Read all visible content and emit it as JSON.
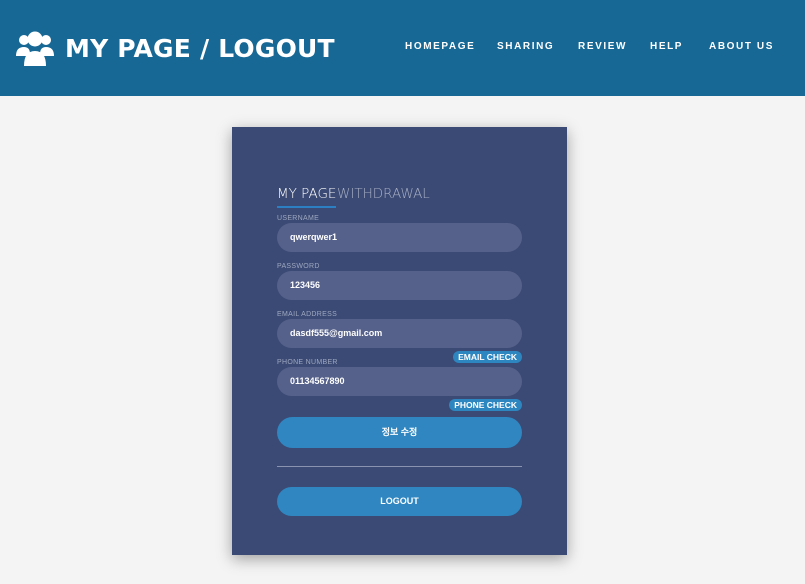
{
  "header": {
    "title": "MY PAGE / LOGOUT",
    "logo_icon": "users-icon",
    "background_color": "#176895",
    "nav": [
      {
        "label": "HOMEPAGE"
      },
      {
        "label": "SHARING"
      },
      {
        "label": "REVIEW"
      },
      {
        "label": "HELP"
      },
      {
        "label": "ABOUT US"
      }
    ]
  },
  "card": {
    "background_color": "#3b4a74",
    "tabs": {
      "active": "MY PAGE",
      "inactive": "WITHDRAWAL"
    },
    "fields": {
      "username": {
        "label": "USERNAME",
        "value": "qwerqwer1"
      },
      "password": {
        "label": "PASSWORD",
        "value": "123456"
      },
      "email": {
        "label": "EMAIL ADDRESS",
        "value": "dasdf555@gmail.com"
      },
      "phone": {
        "label": "PHONE NUMBER",
        "value": "01134567890"
      }
    },
    "email_check_label": "EMAIL CHECK",
    "phone_check_label": "PHONE CHECK",
    "update_button_label": "정보 수정",
    "logout_button_label": "LOGOUT",
    "accent_color": "#2f86c0"
  }
}
